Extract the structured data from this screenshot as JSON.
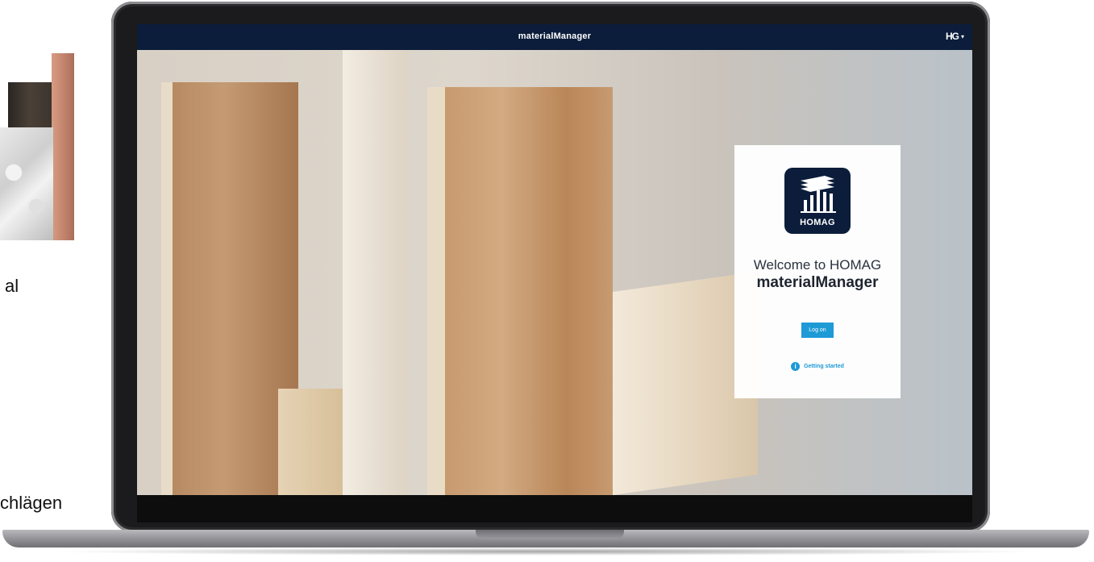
{
  "side": {
    "text_1": "al",
    "text_2": "chlägen"
  },
  "app": {
    "title": "materialManager",
    "user_menu_logo": "HG",
    "user_menu_caret": "▾"
  },
  "login_card": {
    "icon_brand": "HOMAG",
    "welcome_line": "Welcome to HOMAG",
    "product_name": "materialManager",
    "logon_button": "Log on",
    "getting_started_icon": "i",
    "getting_started_link": "Getting started"
  },
  "colors": {
    "header_bg": "#0b1d3a",
    "accent": "#1e9ad6"
  },
  "icons": [
    "homag-app-icon",
    "info-icon",
    "chevron-down-icon"
  ]
}
